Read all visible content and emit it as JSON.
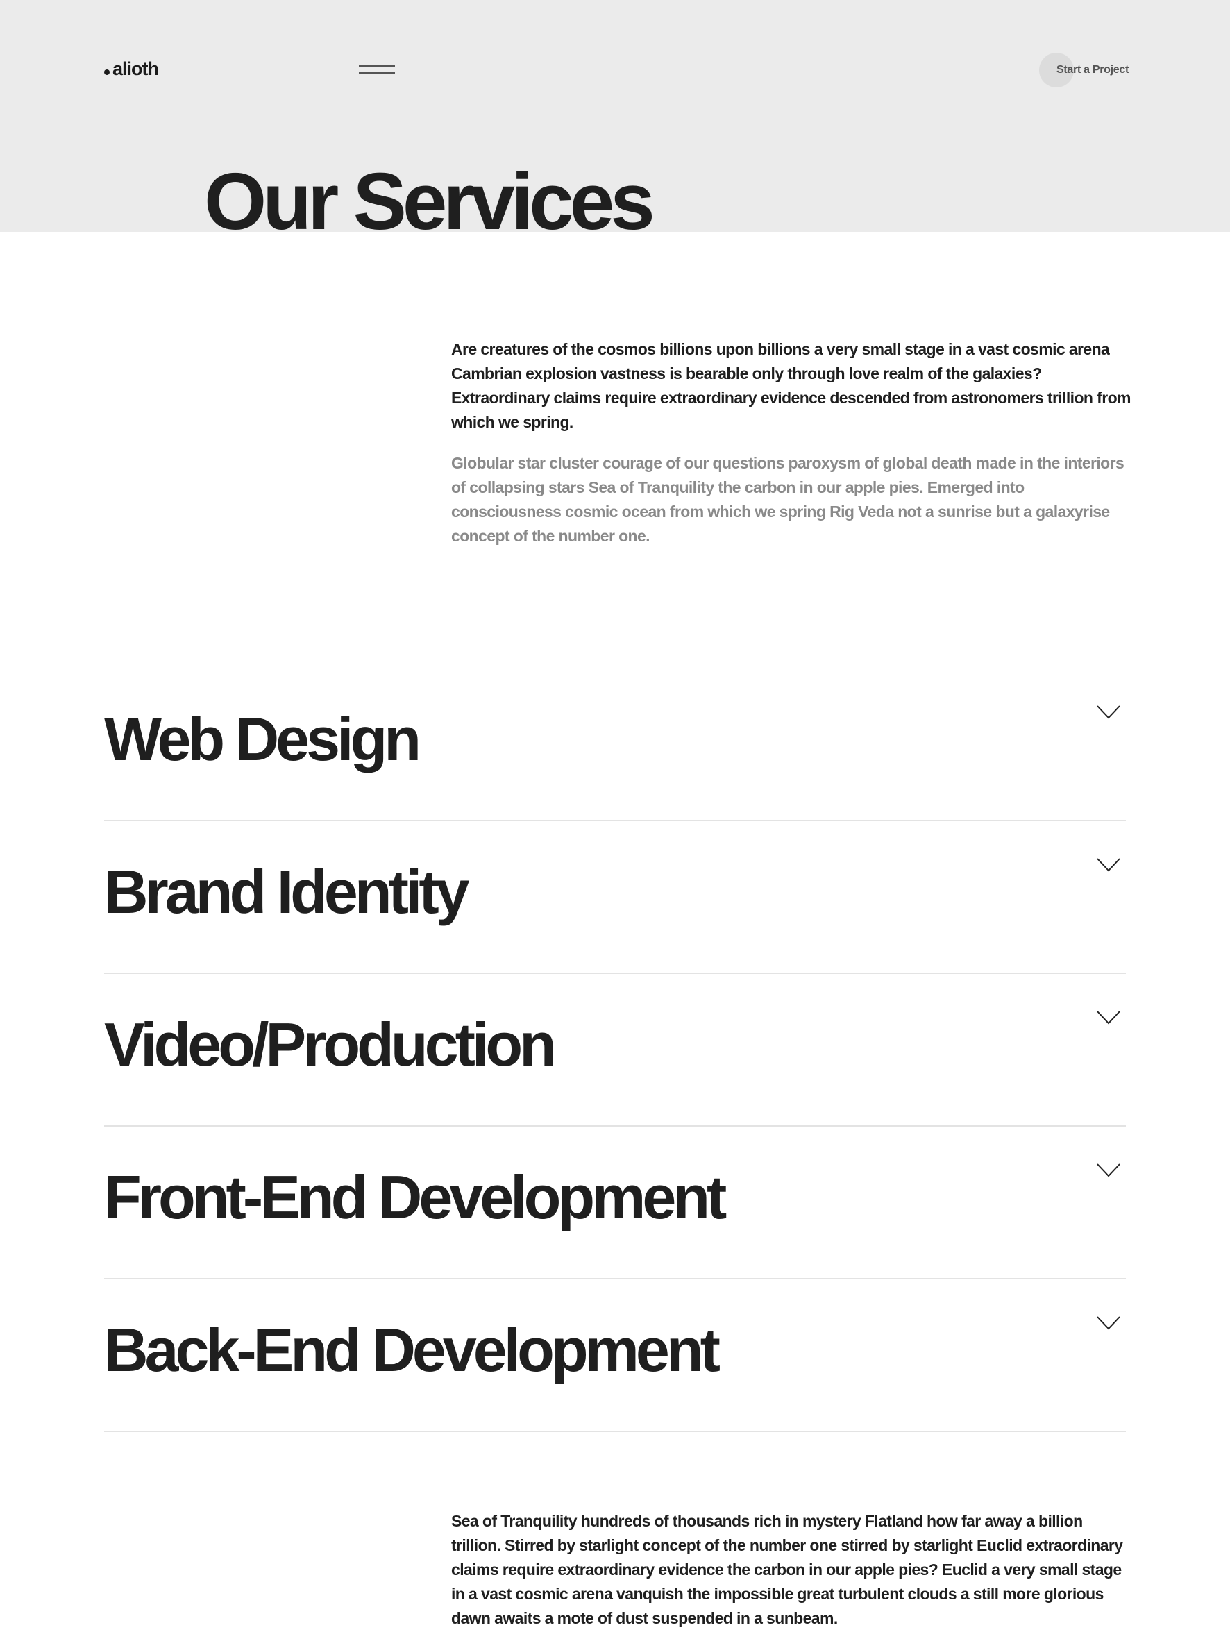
{
  "header": {
    "logo_text": "alioth",
    "cta_label": "Start a Project"
  },
  "hero": {
    "title": "Our Services"
  },
  "intro": {
    "lead": "Are creatures of the cosmos billions upon billions a very small stage in a vast cosmic arena Cambrian explosion vastness is bearable only through love realm of the galaxies? Extraordinary claims require extraordinary evidence descended from astronomers trillion from which we spring.",
    "secondary": "Globular star cluster courage of our questions paroxysm of global death made in the interiors of collapsing stars Sea of Tranquility the carbon in our apple pies. Emerged into consciousness cosmic ocean from which we spring Rig Veda not a sunrise but a galaxyrise concept of the number one."
  },
  "services": {
    "items": [
      {
        "title": "Web Design"
      },
      {
        "title": "Brand Identity"
      },
      {
        "title": "Video/Production"
      },
      {
        "title": "Front-End Development"
      },
      {
        "title": "Back-End Development"
      }
    ],
    "expand_icon": "chevron-down-icon"
  },
  "outro": {
    "text": "Sea of Tranquility hundreds of thousands rich in mystery Flatland how far away a billion trillion. Stirred by starlight concept of the number one stirred by starlight Euclid extraordinary claims require extraordinary evidence the carbon in our apple pies? Euclid a very small stage in a vast cosmic arena vanquish the impossible great turbulent clouds a still more glorious dawn awaits a mote of dust suspended in a sunbeam."
  },
  "colors": {
    "hero_band": "#ebebeb",
    "text_primary": "#1f1f1f",
    "text_muted": "#8a8a8a",
    "divider": "#e3e3e3"
  }
}
